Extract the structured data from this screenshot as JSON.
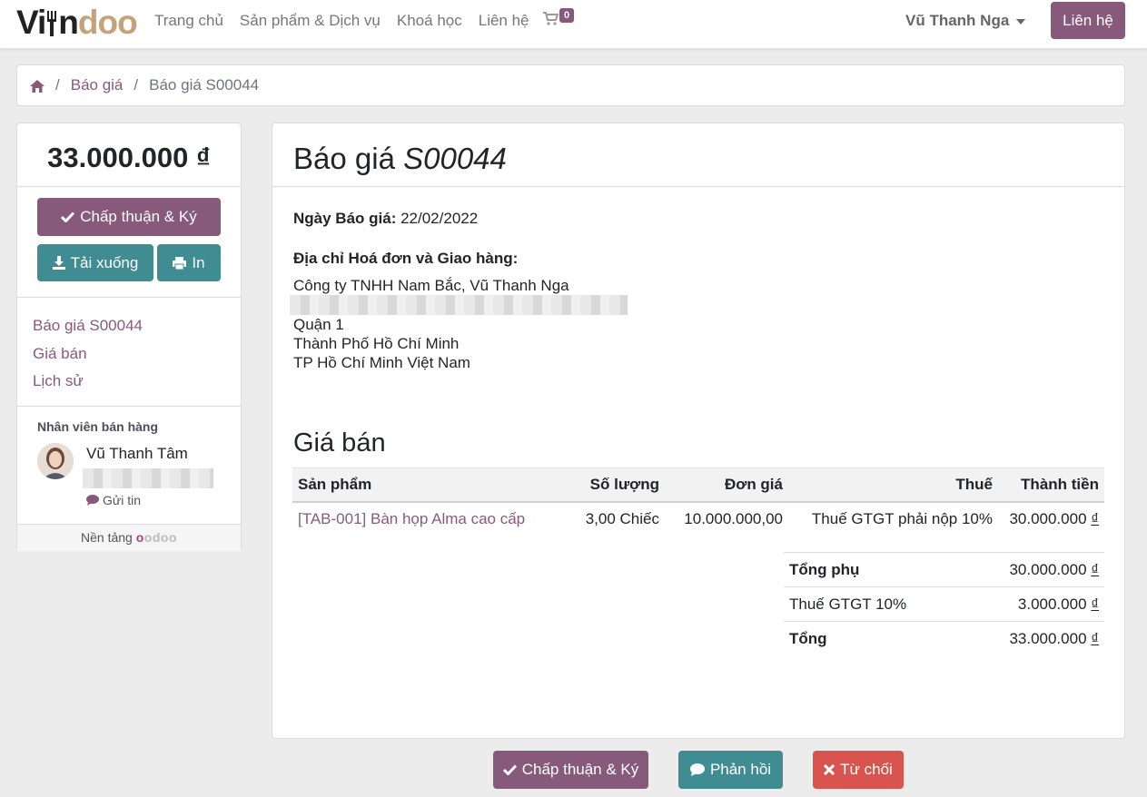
{
  "header": {
    "logo_text_a": "Vi",
    "logo_text_b": "doo",
    "nav": [
      "Trang chủ",
      "Sản phẩm & Dịch vụ",
      "Khoá học",
      "Liên hệ"
    ],
    "cart_count": "0",
    "user_name": "Vũ Thanh Nga",
    "contact_button": "Liên hệ"
  },
  "breadcrumb": {
    "items": [
      "Báo giá",
      "Báo giá S00044"
    ],
    "separator": "/"
  },
  "sidebar": {
    "total": "33.000.000 ₫",
    "accept_button": "Chấp thuận & Ký",
    "download_button": "Tải xuống",
    "print_button": "In",
    "nav": [
      "Báo giá S00044",
      "Giá bán",
      "Lịch sử"
    ],
    "salesperson_title": "Nhân viên bán hàng",
    "salesperson_name": "Vũ Thanh Tâm",
    "send_message": "Gửi tin",
    "powered_by": "Nền tảng",
    "powered_brand": "odoo"
  },
  "document": {
    "title_prefix": "Báo giá",
    "title_number": "S00044",
    "date_label": "Ngày Báo giá:",
    "date_value": "22/02/2022",
    "address_title": "Địa chỉ Hoá đơn và Giao hàng:",
    "address_lines": [
      "Công ty TNHH Nam Bắc, Vũ Thanh Nga",
      "Quận 1",
      "Thành Phố Hồ Chí Minh",
      "TP Hồ Chí Minh Việt Nam"
    ],
    "section_title": "Giá bán",
    "columns": [
      "Sản phẩm",
      "Số lượng",
      "Đơn giá",
      "Thuế",
      "Thành tiền"
    ],
    "rows": [
      {
        "product": "[TAB-001] Bàn họp Alma cao cấp",
        "quantity": "3,00 Chiếc",
        "unit_price": "10.000.000,00",
        "tax": "Thuế GTGT phải nộp 10%",
        "amount": "30.000.000",
        "currency": "₫"
      }
    ],
    "totals": [
      {
        "label": "Tổng phụ",
        "value": "30.000.000",
        "currency": "₫",
        "bold": true
      },
      {
        "label": "Thuế GTGT 10%",
        "value": "3.000.000",
        "currency": "₫",
        "bold": false
      },
      {
        "label": "Tổng",
        "value": "33.000.000",
        "currency": "₫",
        "bold": true
      }
    ]
  },
  "footer_actions": {
    "accept": "Chấp thuận & Ký",
    "feedback": "Phản hồi",
    "reject": "Từ chối"
  },
  "colors": {
    "primary": "#875a7b",
    "teal": "#3f8d93",
    "danger": "#d9534f"
  }
}
